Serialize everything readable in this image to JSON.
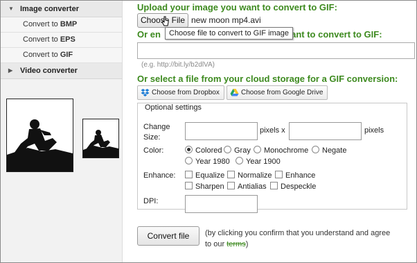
{
  "sidebar": {
    "image_converter": "Image converter",
    "items": [
      {
        "prefix": "Convert to ",
        "format": "BMP"
      },
      {
        "prefix": "Convert to ",
        "format": "EPS"
      },
      {
        "prefix": "Convert to ",
        "format": "GIF"
      }
    ],
    "video_converter": "Video converter"
  },
  "upload": {
    "title": "Upload your image you want to convert to GIF:",
    "choose_label": "Choose File",
    "file_name": "new moon mp4.avi",
    "tooltip": "Choose file to convert to GIF image"
  },
  "url": {
    "title_start": "Or en",
    "title_end": "want to convert to GIF:",
    "value": "",
    "hint": "(e.g. http://bit.ly/b2dlVA)"
  },
  "cloud": {
    "title": "Or select a file from your cloud storage for a GIF conversion:",
    "dropbox_label": "Choose from Dropbox",
    "gdrive_label": "Choose from Google Drive"
  },
  "options": {
    "legend": "Optional settings",
    "change_size_label": "Change Size:",
    "pixels_x": "pixels x",
    "pixels": "pixels",
    "width_value": "",
    "height_value": "",
    "color_label": "Color:",
    "colors": [
      {
        "label": "Colored",
        "selected": true
      },
      {
        "label": "Gray",
        "selected": false
      },
      {
        "label": "Monochrome",
        "selected": false
      },
      {
        "label": "Negate",
        "selected": false
      },
      {
        "label": "Year 1980",
        "selected": false
      },
      {
        "label": "Year 1900",
        "selected": false
      }
    ],
    "enhance_label": "Enhance:",
    "enhance": [
      {
        "label": "Equalize",
        "checked": false
      },
      {
        "label": "Normalize",
        "checked": false
      },
      {
        "label": "Enhance",
        "checked": false
      },
      {
        "label": "Sharpen",
        "checked": false
      },
      {
        "label": "Antialias",
        "checked": false
      },
      {
        "label": "Despeckle",
        "checked": false
      }
    ],
    "dpi_label": "DPI:",
    "dpi_value": ""
  },
  "convert": {
    "label": "Convert file",
    "note_line1": "(by clicking you confirm that you understand and agree",
    "note_prefix": "to our ",
    "terms": "terms",
    "note_suffix": ")"
  },
  "colors": {
    "accent_green": "#3d8a1f"
  },
  "icons": [
    "caret-down-icon",
    "caret-right-icon",
    "dropbox-icon",
    "google-drive-icon",
    "pointer-cursor-icon"
  ]
}
